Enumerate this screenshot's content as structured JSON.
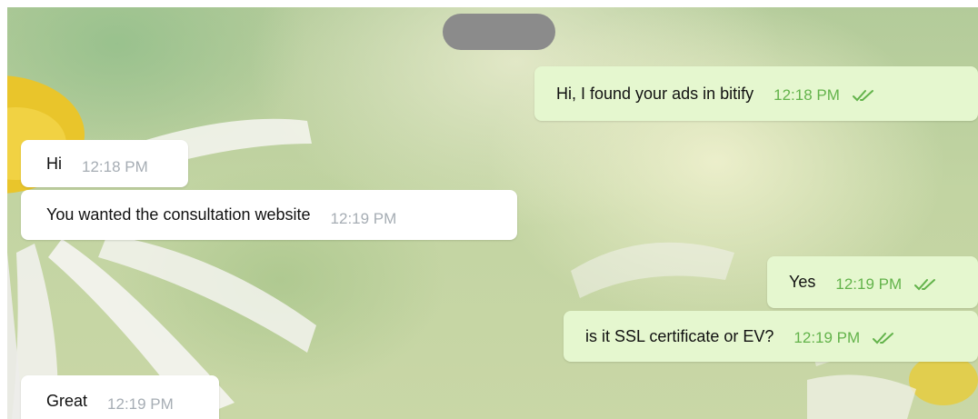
{
  "colors": {
    "incoming_bubble": "#ffffff",
    "outgoing_bubble": "#e5f7cf",
    "outgoing_time": "#63b34b",
    "incoming_time": "#a6adb4",
    "date_pill": "#8b8b8b"
  },
  "chat": {
    "messages": [
      {
        "direction": "outgoing",
        "text": "Hi, I found your ads in bitify",
        "time": "12:18 PM",
        "status_icon": "double-check-icon"
      },
      {
        "direction": "incoming",
        "text": "Hi",
        "time": "12:18 PM"
      },
      {
        "direction": "incoming",
        "text": "You wanted the consultation website",
        "time": "12:19 PM"
      },
      {
        "direction": "outgoing",
        "text": "Yes",
        "time": "12:19 PM",
        "status_icon": "double-check-icon"
      },
      {
        "direction": "outgoing",
        "text": "is it SSL certificate or EV?",
        "time": "12:19 PM",
        "status_icon": "double-check-icon"
      },
      {
        "direction": "incoming",
        "text": "Great",
        "time": "12:19 PM"
      }
    ]
  }
}
